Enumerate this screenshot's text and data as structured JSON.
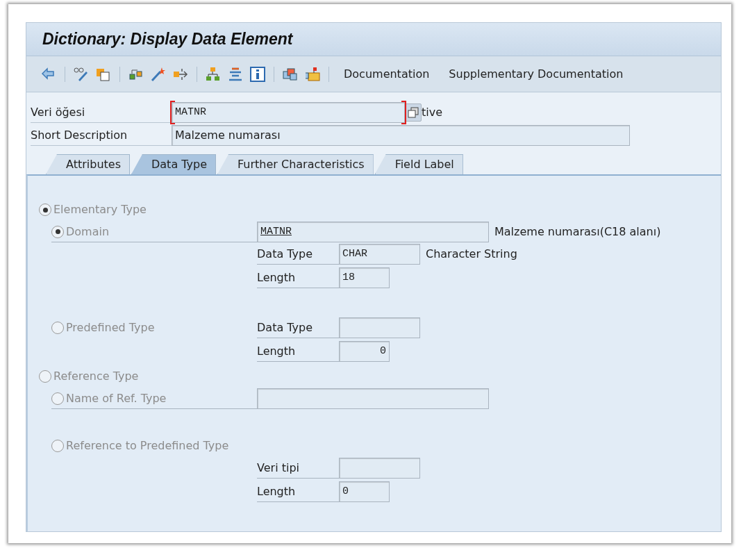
{
  "window": {
    "title": "Dictionary: Display Data Element"
  },
  "toolbar": {
    "text_buttons": [
      "Documentation",
      "Supplementary Documentation"
    ]
  },
  "header": {
    "element": {
      "label": "Veri öğesi",
      "value": "MATNR",
      "focused": true
    },
    "status_fragment": "tive",
    "short_description": {
      "label": "Short Description",
      "value": "Malzeme numarası"
    }
  },
  "tabs": [
    {
      "label": "Attributes",
      "selected": false
    },
    {
      "label": "Data Type",
      "selected": true
    },
    {
      "label": "Further Characteristics",
      "selected": false
    },
    {
      "label": "Field Label",
      "selected": false
    }
  ],
  "type_groups": [
    {
      "label": "Elementary Type",
      "selected": true,
      "disabled": true,
      "options": [
        {
          "kind": "field",
          "label": "Domain",
          "selected": true,
          "disabled": true,
          "value": "MATNR",
          "description": "Malzeme numarası(C18 alanı)",
          "details": [
            {
              "kind": "type",
              "label": "Data Type",
              "value": "CHAR",
              "note": "Character String"
            },
            {
              "kind": "length",
              "label": "Length",
              "value": "18"
            }
          ]
        },
        {
          "kind": "inline",
          "label": "Predefined Type",
          "selected": false,
          "disabled": true,
          "details": [
            {
              "kind": "type",
              "label": "Data Type"
            },
            {
              "kind": "numeric_length",
              "label": "Length",
              "value": "0"
            }
          ]
        }
      ]
    },
    {
      "label": "Reference Type",
      "selected": false,
      "disabled": true,
      "options": [
        {
          "kind": "field",
          "label": "Name of Ref. Type",
          "selected": false,
          "disabled": true
        },
        {
          "kind": "stacked",
          "label": "Reference to Predefined Type",
          "selected": false,
          "disabled": true,
          "details": [
            {
              "kind": "type",
              "label": "Veri tipi"
            },
            {
              "kind": "length",
              "label": "Length",
              "value": "0"
            }
          ]
        }
      ]
    }
  ]
}
